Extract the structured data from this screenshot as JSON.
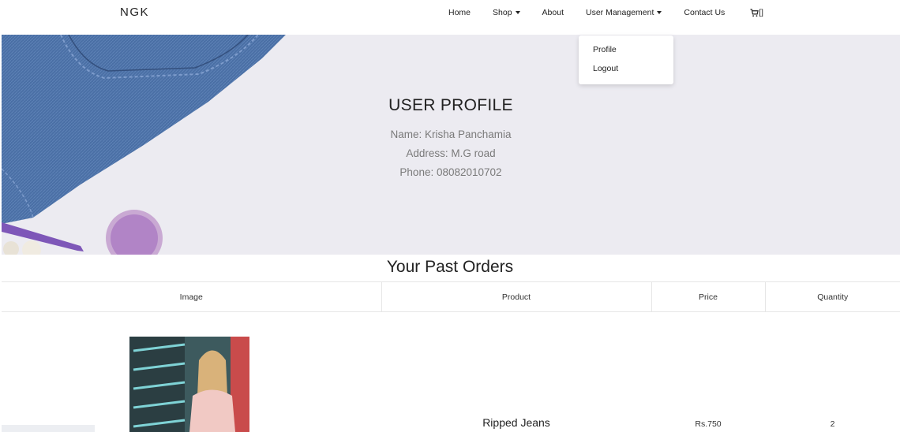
{
  "navbar": {
    "brand": "NGK",
    "items": [
      {
        "label": "Home",
        "dropdown": false
      },
      {
        "label": "Shop",
        "dropdown": true
      },
      {
        "label": "About",
        "dropdown": false
      },
      {
        "label": "User Management",
        "dropdown": true
      },
      {
        "label": "Contact Us",
        "dropdown": false
      }
    ],
    "cart_icon": "cart-icon",
    "cart_count": "[]"
  },
  "user_menu": {
    "items": [
      "Profile",
      "Logout"
    ]
  },
  "profile": {
    "title": "USER PROFILE",
    "name": "Name: Krisha Panchamia",
    "address": "Address: M.G road",
    "phone": "Phone: 08082010702"
  },
  "orders": {
    "title": "Your Past Orders",
    "columns": [
      "Image",
      "Product",
      "Price",
      "Quantity"
    ],
    "rows": [
      {
        "image": "product-photo",
        "product": "Ripped Jeans",
        "price": "Rs.750",
        "quantity": "2"
      }
    ]
  },
  "colors": {
    "hero_background": "#ecebf1",
    "denim": "#4a6fa5",
    "accent_purple": "#b184c6"
  }
}
